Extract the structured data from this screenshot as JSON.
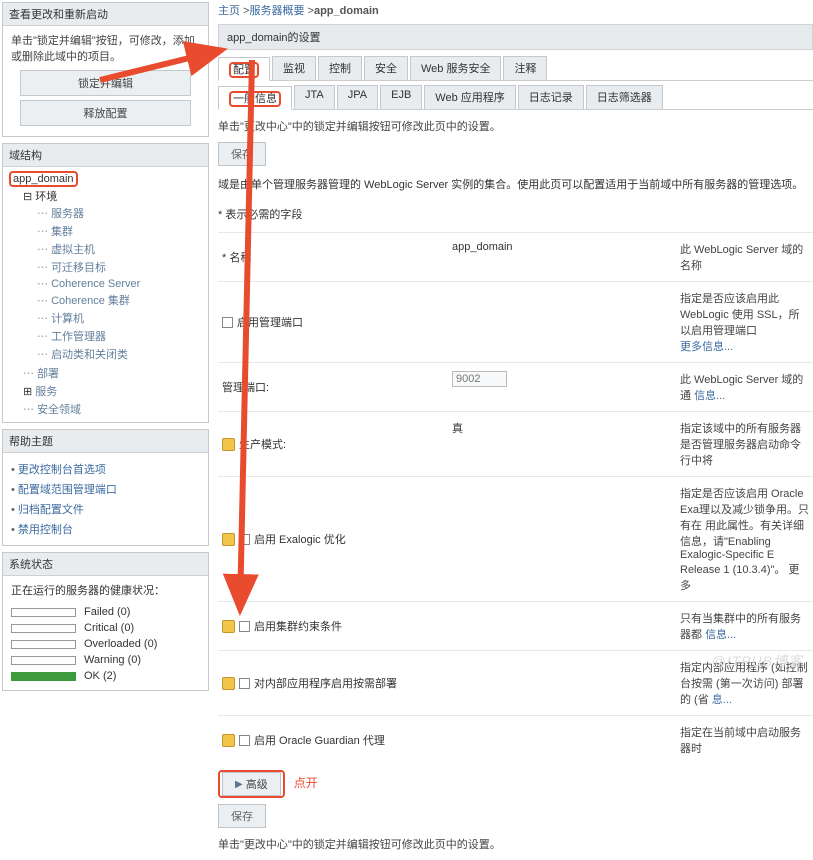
{
  "left": {
    "change_center": {
      "title": "查看更改和重新启动",
      "note": "单击\"锁定并编辑\"按钮，可修改，添加或删除此域中的项目。",
      "lock_btn": "锁定并编辑",
      "release_btn": "释放配置"
    },
    "domain_tree": {
      "title": "域结构",
      "root": "app_domain",
      "env": "环境",
      "items": [
        "服务器",
        "集群",
        "虚拟主机",
        "可迁移目标",
        "Coherence Server",
        "Coherence 集群",
        "计算机",
        "工作管理器",
        "启动类和关闭类"
      ],
      "dept": "部署",
      "svc": "服务",
      "sec": "安全领域"
    },
    "help": {
      "title": "帮助主题",
      "items": [
        "更改控制台首选项",
        "配置域范围管理端口",
        "归档配置文件",
        "禁用控制台"
      ]
    },
    "status": {
      "title": "系统状态",
      "running": "正在运行的服务器的健康状况：",
      "rows": [
        {
          "label": "Failed (0)",
          "cls": ""
        },
        {
          "label": "Critical (0)",
          "cls": ""
        },
        {
          "label": "Overloaded (0)",
          "cls": ""
        },
        {
          "label": "Warning (0)",
          "cls": ""
        },
        {
          "label": "OK (2)",
          "cls": "ok"
        }
      ]
    }
  },
  "right": {
    "breadcrumb": {
      "home": "主页",
      "mid": "服务器概要",
      "cur": "app_domain"
    },
    "settings_title": "app_domain的设置",
    "tabs1": [
      "配置",
      "监视",
      "控制",
      "安全",
      "Web 服务安全",
      "注释"
    ],
    "tabs2": [
      "一般信息",
      "JTA",
      "JPA",
      "EJB",
      "Web 应用程序",
      "日志记录",
      "日志筛选器"
    ],
    "instr_top": "单击\"更改中心\"中的锁定并编辑按钮可修改此页中的设置。",
    "save": "保存",
    "desc": "域是由单个管理服务器管理的 WebLogic Server 实例的集合。使用此页可以配置适用于当前域中所有服务器的管理选项。",
    "req_note": "* 表示必需的字段",
    "rows": {
      "name": {
        "lbl": "* 名称",
        "val": "app_domain",
        "hint": "此 WebLogic Server 域的名称"
      },
      "admport": {
        "lbl": "启用管理端口",
        "hint": "指定是否应该启用此 WebLogic 使用 SSL，所以启用管理端口",
        "more": "更多信息..."
      },
      "port": {
        "lbl": "管理端口:",
        "val": "9002",
        "hint": "此 WebLogic Server 域的通",
        "more": "信息..."
      },
      "prod": {
        "lbl": "生产模式:",
        "val": "真",
        "hint": "指定该域中的所有服务器是否管理服务器启动命令行中将"
      },
      "exa": {
        "lbl": "启用 Exalogic 优化",
        "hint": "指定是否应该启用 Oracle Exa理以及减少锁争用。只有在 用此属性。有关详细信息，请\"Enabling Exalogic-Specific E Release 1 (10.3.4)\"。   更多"
      },
      "cluster": {
        "lbl": "启用集群约束条件",
        "hint": "只有当集群中的所有服务器都",
        "more": "信息..."
      },
      "demand": {
        "lbl": "对内部应用程序启用按需部署",
        "hint": "指定内部应用程序 (如控制台按需 (第一次访问) 部署的 (省",
        "more": "息..."
      },
      "guard": {
        "lbl": "启用 Oracle Guardian 代理",
        "hint": "指定在当前域中启动服务器时"
      }
    },
    "advanced": "高级",
    "click_open": "点开",
    "instr_bottom": "单击\"更改中心\"中的锁定并编辑按钮可修改此页中的设置。",
    "watermark": "@ITPUB博客"
  }
}
